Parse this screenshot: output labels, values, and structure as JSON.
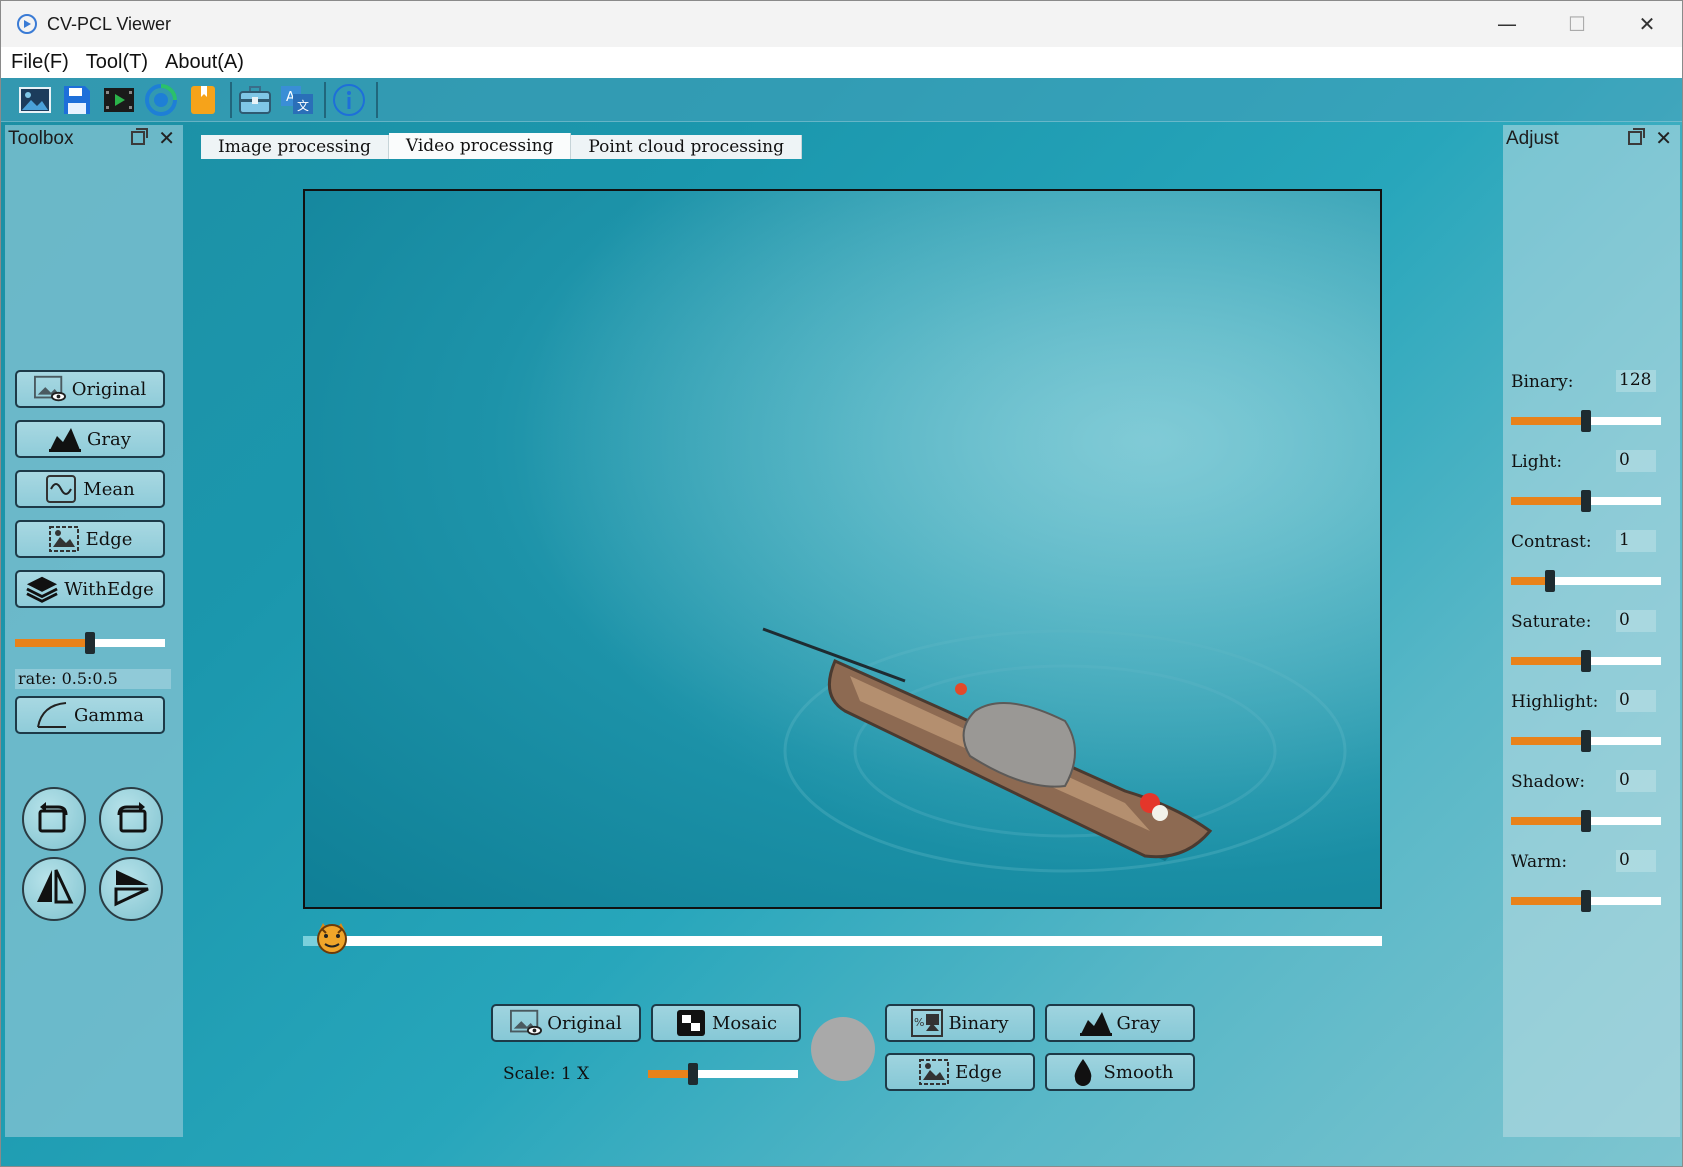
{
  "window": {
    "title": "CV-PCL Viewer",
    "minimize": "—",
    "maximize": "☐",
    "close": "✕"
  },
  "menu": {
    "file": "File(F)",
    "tool": "Tool(T)",
    "about": "About(A)"
  },
  "toolbar": {
    "icons": [
      "open-image-icon",
      "save-icon",
      "video-icon",
      "refresh-icon",
      "bookmark-icon",
      "toolbox-icon",
      "translate-icon",
      "info-icon"
    ]
  },
  "toolbox": {
    "title": "Toolbox",
    "buttons": {
      "original": "Original",
      "gray": "Gray",
      "mean": "Mean",
      "edge": "Edge",
      "withedge": "WithEdge",
      "gamma": "Gamma"
    },
    "rate_label": "rate: 0.5:0.5",
    "rate_slider": 0.5
  },
  "tabs": {
    "image": "Image processing",
    "video": "Video processing",
    "pointcloud": "Point cloud processing",
    "active": "video"
  },
  "video": {
    "progress": 0.02
  },
  "bottom": {
    "original": "Original",
    "mosaic": "Mosaic",
    "binary": "Binary",
    "gray": "Gray",
    "edge": "Edge",
    "smooth": "Smooth",
    "scale_label": "Scale: 1 X",
    "scale_slider": 0.3
  },
  "adjust": {
    "title": "Adjust",
    "binary": {
      "label": "Binary:",
      "value": "128",
      "level": 0.5
    },
    "light": {
      "label": "Light:",
      "value": "0",
      "level": 0.5
    },
    "contrast": {
      "label": "Contrast:",
      "value": "1",
      "level": 0.26
    },
    "saturate": {
      "label": "Saturate:",
      "value": "0",
      "level": 0.5
    },
    "highlight": {
      "label": "Highlight:",
      "value": "0",
      "level": 0.5
    },
    "shadow": {
      "label": "Shadow:",
      "value": "0",
      "level": 0.5
    },
    "warm": {
      "label": "Warm:",
      "value": "0",
      "level": 0.5
    }
  },
  "colors": {
    "accent_orange": "#e8821a",
    "slider_track": "#ffffff",
    "button_bg": "#9fd4df",
    "button_border": "#1d3a48"
  }
}
